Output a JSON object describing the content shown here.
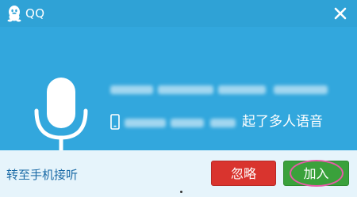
{
  "window": {
    "title": "QQ",
    "close_icon": "close-icon",
    "logo_icon": "qq-penguin-icon",
    "header_color": "#2fa2d6",
    "main_color": "#32a7dd"
  },
  "call": {
    "mic_icon": "microphone-icon",
    "phone_icon": "mobile-phone-icon",
    "message": "起了多人语音"
  },
  "footer": {
    "transfer_label": "转至手机接听",
    "ignore_label": "忽略",
    "join_label": "加入",
    "ignore_color": "#d9342e",
    "join_color": "#3aa13b",
    "highlight_color": "#e75aa8"
  }
}
